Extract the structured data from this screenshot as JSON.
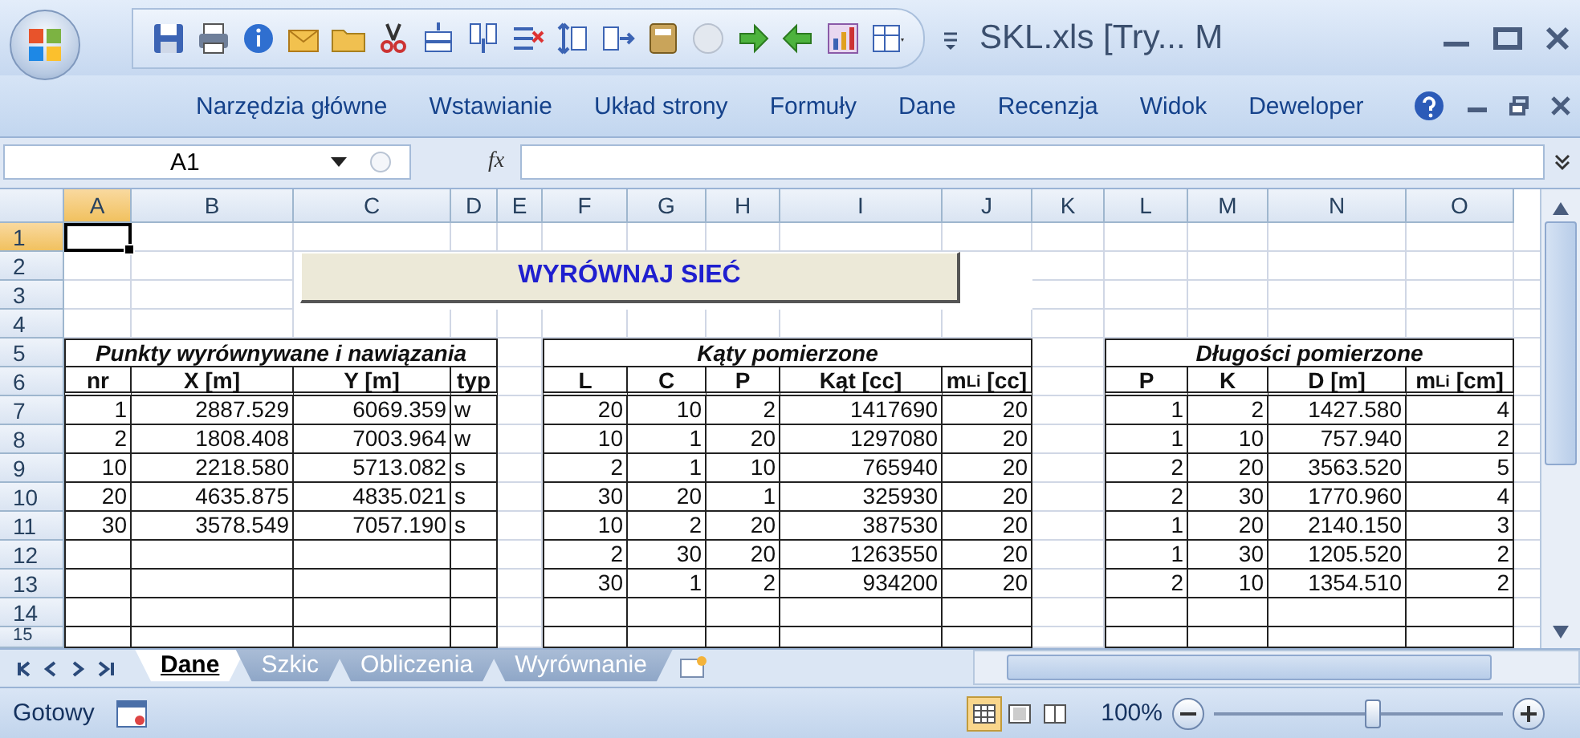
{
  "window": {
    "title": "SKL.xls  [Try... M"
  },
  "ribbon_tabs": [
    "Narzędzia główne",
    "Wstawianie",
    "Układ strony",
    "Formuły",
    "Dane",
    "Recenzja",
    "Widok",
    "Deweloper"
  ],
  "formula_bar": {
    "name_box": "A1",
    "fx_label": "fx"
  },
  "sheet": {
    "columns": [
      {
        "label": "A",
        "selected": true
      },
      {
        "label": "B",
        "selected": false
      },
      {
        "label": "C",
        "selected": false
      },
      {
        "label": "D",
        "selected": false
      },
      {
        "label": "E",
        "selected": false
      },
      {
        "label": "F",
        "selected": false
      },
      {
        "label": "G",
        "selected": false
      },
      {
        "label": "H",
        "selected": false
      },
      {
        "label": "I",
        "selected": false
      },
      {
        "label": "J",
        "selected": false
      },
      {
        "label": "K",
        "selected": false
      },
      {
        "label": "L",
        "selected": false
      },
      {
        "label": "M",
        "selected": false
      },
      {
        "label": "N",
        "selected": false
      },
      {
        "label": "O",
        "selected": false
      }
    ],
    "rows": [
      {
        "label": "1",
        "selected": true
      },
      {
        "label": "2",
        "selected": false
      },
      {
        "label": "3",
        "selected": false
      },
      {
        "label": "4",
        "selected": false
      },
      {
        "label": "5",
        "selected": false
      },
      {
        "label": "6",
        "selected": false
      },
      {
        "label": "7",
        "selected": false
      },
      {
        "label": "8",
        "selected": false
      },
      {
        "label": "9",
        "selected": false
      },
      {
        "label": "10",
        "selected": false
      },
      {
        "label": "11",
        "selected": false
      },
      {
        "label": "12",
        "selected": false
      },
      {
        "label": "13",
        "selected": false
      },
      {
        "label": "14",
        "selected": false
      },
      {
        "label": "15",
        "selected": false
      }
    ],
    "button": "WYRÓWNAJ SIEĆ",
    "tables": [
      {
        "title": "Punkty wyrównywane i nawiązania",
        "headers": [
          "nr",
          "X [m]",
          "Y [m]",
          "typ"
        ],
        "rows": [
          [
            "1",
            "2887.529",
            "6069.359",
            "w"
          ],
          [
            "2",
            "1808.408",
            "7003.964",
            "w"
          ],
          [
            "10",
            "2218.580",
            "5713.082",
            "s"
          ],
          [
            "20",
            "4635.875",
            "4835.021",
            "s"
          ],
          [
            "30",
            "3578.549",
            "7057.190",
            "s"
          ]
        ]
      },
      {
        "title": "Kąty pomierzone",
        "headers": [
          "L",
          "C",
          "P",
          "Kąt [cc]",
          "m$_{Li}$ [cc]"
        ],
        "rows": [
          [
            "20",
            "10",
            "2",
            "1417690",
            "20"
          ],
          [
            "10",
            "1",
            "20",
            "1297080",
            "20"
          ],
          [
            "2",
            "1",
            "10",
            "765940",
            "20"
          ],
          [
            "30",
            "20",
            "1",
            "325930",
            "20"
          ],
          [
            "10",
            "2",
            "20",
            "387530",
            "20"
          ],
          [
            "2",
            "30",
            "20",
            "1263550",
            "20"
          ],
          [
            "30",
            "1",
            "2",
            "934200",
            "20"
          ]
        ]
      },
      {
        "title": "Długości pomierzone",
        "headers": [
          "P",
          "K",
          "D [m]",
          "m$_{Li}$ [cm]"
        ],
        "rows": [
          [
            "1",
            "2",
            "1427.580",
            "4"
          ],
          [
            "1",
            "10",
            "757.940",
            "2"
          ],
          [
            "2",
            "20",
            "3563.520",
            "5"
          ],
          [
            "2",
            "30",
            "1770.960",
            "4"
          ],
          [
            "1",
            "20",
            "2140.150",
            "3"
          ],
          [
            "1",
            "30",
            "1205.520",
            "2"
          ],
          [
            "2",
            "10",
            "1354.510",
            "2"
          ]
        ]
      }
    ]
  },
  "sheet_tabs": [
    {
      "label": "Dane",
      "selected": true
    },
    {
      "label": "Szkic",
      "selected": false
    },
    {
      "label": "Obliczenia",
      "selected": false
    },
    {
      "label": "Wyrównanie",
      "selected": false
    }
  ],
  "status_bar": {
    "text": "Gotowy",
    "zoom": "100%",
    "zoom_slider": {
      "level": 0.55
    }
  }
}
